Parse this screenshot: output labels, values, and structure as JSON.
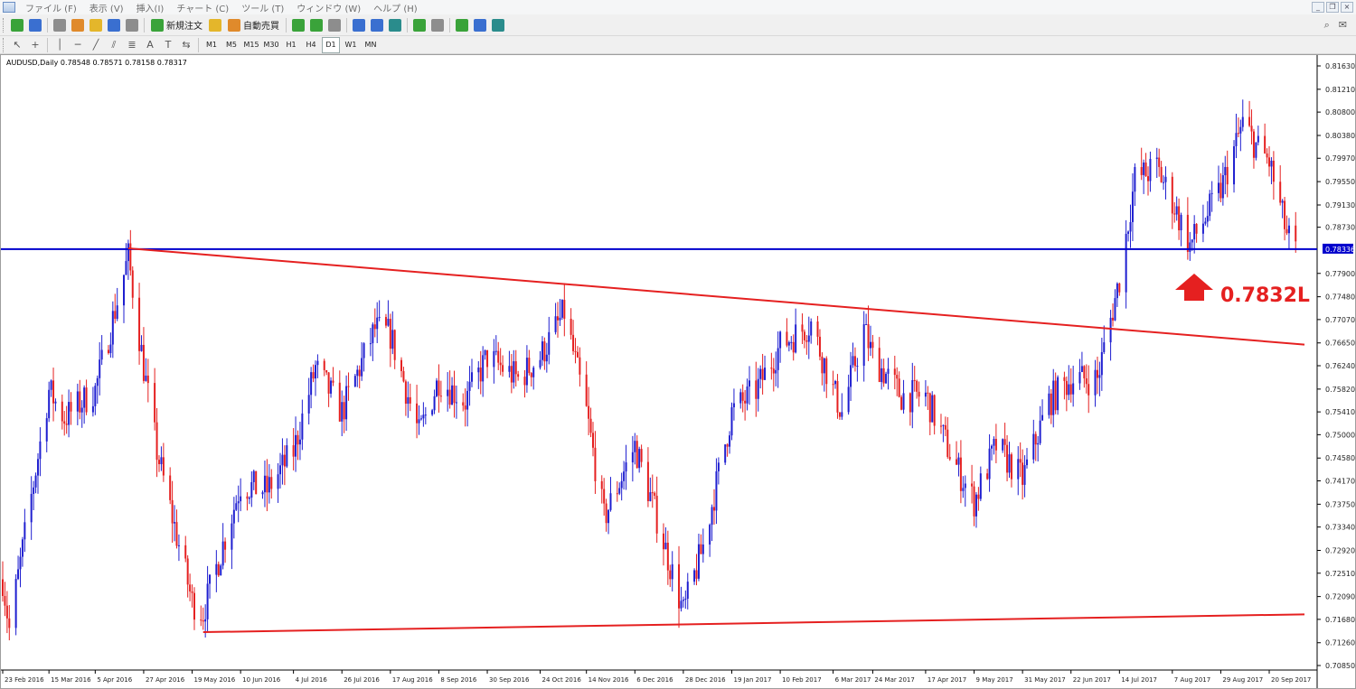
{
  "window": {
    "menu": [
      "ファイル (F)",
      "表示 (V)",
      "挿入(I)",
      "チャート (C)",
      "ツール (T)",
      "ウィンドウ (W)",
      "ヘルプ (H)"
    ],
    "controls": [
      "_",
      "❐",
      "×"
    ]
  },
  "toolbar": {
    "new_order_label": "新規注文",
    "auto_trade_label": "自動売買",
    "timeframes": [
      "M1",
      "M5",
      "M15",
      "M30",
      "H1",
      "H4",
      "D1",
      "W1",
      "MN"
    ],
    "active_timeframe": "D1"
  },
  "chart": {
    "symbol_info": "AUDUSD,Daily  0.78548 0.78571 0.78158 0.78317",
    "current_price_label": "0.78336",
    "callout_label": "0.7832L",
    "colors": {
      "bull": "#1f1fd0",
      "bear": "#e52020",
      "horizontal_line": "#0000cc",
      "trendline": "#e52020",
      "arrow": "#e52020"
    }
  },
  "chart_data": {
    "type": "candlestick",
    "symbol": "AUDUSD",
    "timeframe": "Daily",
    "ohlc_current": {
      "open": 0.78548,
      "high": 0.78571,
      "low": 0.78158,
      "close": 0.78317
    },
    "y_ticks": [
      "0.81630",
      "0.81210",
      "0.80800",
      "0.80380",
      "0.79970",
      "0.79550",
      "0.79130",
      "0.78730",
      "0.78336",
      "0.77900",
      "0.77480",
      "0.77070",
      "0.76650",
      "0.76240",
      "0.75820",
      "0.75410",
      "0.75000",
      "0.74580",
      "0.74170",
      "0.73750",
      "0.73340",
      "0.72920",
      "0.72510",
      "0.72090",
      "0.71680",
      "0.71260",
      "0.70850"
    ],
    "x_ticks": [
      "23 Feb 2016",
      "15 Mar 2016",
      "5 Apr 2016",
      "27 Apr 2016",
      "19 May 2016",
      "10 Jun 2016",
      "4 Jul 2016",
      "26 Jul 2016",
      "17 Aug 2016",
      "8 Sep 2016",
      "30 Sep 2016",
      "24 Oct 2016",
      "14 Nov 2016",
      "6 Dec 2016",
      "28 Dec 2016",
      "19 Jan 2017",
      "10 Feb 2017",
      "6 Mar 2017",
      "24 Mar 2017",
      "17 Apr 2017",
      "9 May 2017",
      "31 May 2017",
      "22 Jun 2017",
      "14 Jul 2017",
      "7 Aug 2017",
      "29 Aug 2017",
      "20 Sep 2017"
    ],
    "ylim": [
      0.7085,
      0.8163
    ],
    "horizontal_line": 0.78336,
    "upper_trendline": [
      {
        "date": "2016-04-20",
        "price": 0.7835
      },
      {
        "date": "2017-10-06",
        "price": 0.7662
      }
    ],
    "lower_trendline": [
      {
        "date": "2016-05-24",
        "price": 0.7145
      },
      {
        "date": "2017-10-06",
        "price": 0.7177
      }
    ],
    "price_path": [
      {
        "date": "2016-02-23",
        "price": 0.724
      },
      {
        "date": "2016-02-26",
        "price": 0.715
      },
      {
        "date": "2016-03-15",
        "price": 0.758
      },
      {
        "date": "2016-03-22",
        "price": 0.753
      },
      {
        "date": "2016-04-05",
        "price": 0.758
      },
      {
        "date": "2016-04-20",
        "price": 0.782
      },
      {
        "date": "2016-04-27",
        "price": 0.762
      },
      {
        "date": "2016-05-03",
        "price": 0.747
      },
      {
        "date": "2016-05-19",
        "price": 0.72
      },
      {
        "date": "2016-05-24",
        "price": 0.718
      },
      {
        "date": "2016-06-10",
        "price": 0.741
      },
      {
        "date": "2016-06-22",
        "price": 0.74
      },
      {
        "date": "2016-07-04",
        "price": 0.747
      },
      {
        "date": "2016-07-14",
        "price": 0.762
      },
      {
        "date": "2016-07-26",
        "price": 0.754
      },
      {
        "date": "2016-08-10",
        "price": 0.769
      },
      {
        "date": "2016-08-17",
        "price": 0.768
      },
      {
        "date": "2016-08-30",
        "price": 0.75
      },
      {
        "date": "2016-09-08",
        "price": 0.76
      },
      {
        "date": "2016-09-20",
        "price": 0.756
      },
      {
        "date": "2016-09-30",
        "price": 0.764
      },
      {
        "date": "2016-10-14",
        "price": 0.76
      },
      {
        "date": "2016-10-24",
        "price": 0.764
      },
      {
        "date": "2016-11-04",
        "price": 0.772
      },
      {
        "date": "2016-11-14",
        "price": 0.754
      },
      {
        "date": "2016-11-22",
        "price": 0.735
      },
      {
        "date": "2016-12-06",
        "price": 0.748
      },
      {
        "date": "2016-12-16",
        "price": 0.735
      },
      {
        "date": "2016-12-28",
        "price": 0.718
      },
      {
        "date": "2017-01-06",
        "price": 0.73
      },
      {
        "date": "2017-01-19",
        "price": 0.754
      },
      {
        "date": "2017-01-30",
        "price": 0.758
      },
      {
        "date": "2017-02-10",
        "price": 0.766
      },
      {
        "date": "2017-02-24",
        "price": 0.77
      },
      {
        "date": "2017-03-06",
        "price": 0.758
      },
      {
        "date": "2017-03-10",
        "price": 0.754
      },
      {
        "date": "2017-03-20",
        "price": 0.769
      },
      {
        "date": "2017-03-24",
        "price": 0.764
      },
      {
        "date": "2017-04-06",
        "price": 0.757
      },
      {
        "date": "2017-04-17",
        "price": 0.757
      },
      {
        "date": "2017-04-30",
        "price": 0.745
      },
      {
        "date": "2017-05-09",
        "price": 0.738
      },
      {
        "date": "2017-05-19",
        "price": 0.748
      },
      {
        "date": "2017-05-31",
        "price": 0.742
      },
      {
        "date": "2017-06-12",
        "price": 0.756
      },
      {
        "date": "2017-06-22",
        "price": 0.76
      },
      {
        "date": "2017-07-04",
        "price": 0.76
      },
      {
        "date": "2017-07-14",
        "price": 0.778
      },
      {
        "date": "2017-07-21",
        "price": 0.796
      },
      {
        "date": "2017-07-31",
        "price": 0.798
      },
      {
        "date": "2017-08-07",
        "price": 0.792
      },
      {
        "date": "2017-08-15",
        "price": 0.784
      },
      {
        "date": "2017-08-29",
        "price": 0.794
      },
      {
        "date": "2017-09-08",
        "price": 0.806
      },
      {
        "date": "2017-09-14",
        "price": 0.802
      },
      {
        "date": "2017-09-20",
        "price": 0.799
      },
      {
        "date": "2017-09-28",
        "price": 0.786
      },
      {
        "date": "2017-10-02",
        "price": 0.783
      }
    ]
  }
}
